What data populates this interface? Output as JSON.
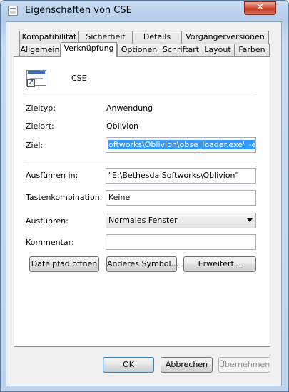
{
  "window": {
    "title": "Eigenschaften von CSE",
    "close_glyph": "✕"
  },
  "tabs_row1": [
    {
      "label": "Kompatibilität"
    },
    {
      "label": "Sicherheit"
    },
    {
      "label": "Details"
    },
    {
      "label": "Vorgängerversionen"
    }
  ],
  "tabs_row2": [
    {
      "label": "Allgemein"
    },
    {
      "label": "Verknüpfung",
      "active": true
    },
    {
      "label": "Optionen"
    },
    {
      "label": "Schriftart"
    },
    {
      "label": "Layout"
    },
    {
      "label": "Farben"
    }
  ],
  "shortcut": {
    "name": "CSE",
    "icon": "shortcut-icon"
  },
  "info": {
    "zieltyp_label": "Zieltyp:",
    "zieltyp_value": "Anwendung",
    "zielort_label": "Zielort:",
    "zielort_value": "Oblivion",
    "ziel_label": "Ziel:",
    "ziel_value": "oftworks\\Oblivion\\obse_loader.exe\" -editor"
  },
  "form": {
    "ausfuehren_in_label": "Ausführen in:",
    "ausfuehren_in_value": "\"E:\\Bethesda Softworks\\Oblivion\"",
    "tastenkombination_label": "Tastenkombination:",
    "tastenkombination_value": "Keine",
    "ausfuehren_label": "Ausführen:",
    "ausfuehren_value": "Normales Fenster",
    "kommentar_label": "Kommentar:",
    "kommentar_value": ""
  },
  "panel_buttons": {
    "open_path": "Dateipfad öffnen",
    "change_icon": "Anderes Symbol...",
    "advanced": "Erweitert..."
  },
  "dialog_buttons": {
    "ok": "OK",
    "cancel": "Abbrechen",
    "apply": "Übernehmen"
  }
}
